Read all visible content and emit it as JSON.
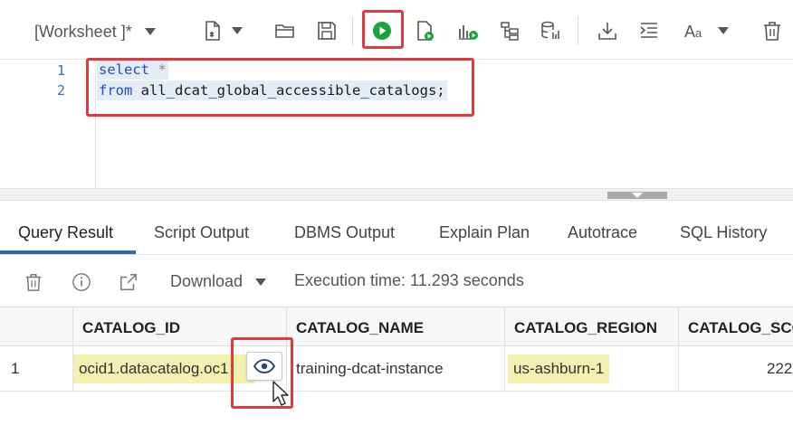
{
  "toolbar": {
    "worksheet_label": "[Worksheet ]*",
    "icons": [
      "new-worksheet-icon",
      "open-folder-icon",
      "save-icon",
      "run-statement-icon",
      "run-script-icon",
      "explain-plan-icon",
      "autotrace-icon",
      "clear-output-icon",
      "download-icon",
      "format-icon",
      "font-case-icon",
      "delete-icon"
    ],
    "accent_run": "#1aa33a",
    "highlight_color": "#e0393e"
  },
  "editor": {
    "lines": [
      {
        "number": "1",
        "keyword": "select",
        "rest": " *"
      },
      {
        "number": "2",
        "keyword": "from",
        "rest": " all_dcat_global_accessible_catalogs;"
      }
    ]
  },
  "tabs": [
    {
      "label": "Query Result",
      "active": true
    },
    {
      "label": "Script Output",
      "active": false
    },
    {
      "label": "DBMS Output",
      "active": false
    },
    {
      "label": "Explain Plan",
      "active": false
    },
    {
      "label": "Autotrace",
      "active": false
    },
    {
      "label": "SQL History",
      "active": false
    }
  ],
  "results_toolbar": {
    "download_label": "Download",
    "execution_time": "Execution time: 11.293 seconds"
  },
  "grid": {
    "columns": [
      "CATALOG_ID",
      "CATALOG_NAME",
      "CATALOG_REGION",
      "CATALOG_SCO"
    ],
    "rows": [
      {
        "row_number": "1",
        "catalog_id": "ocid1.datacatalog.oc1",
        "catalog_name": "training-dcat-instance",
        "catalog_region": "us-ashburn-1",
        "catalog_scope": "222"
      }
    ],
    "cell_highlight_color": "#f3f0b0"
  }
}
